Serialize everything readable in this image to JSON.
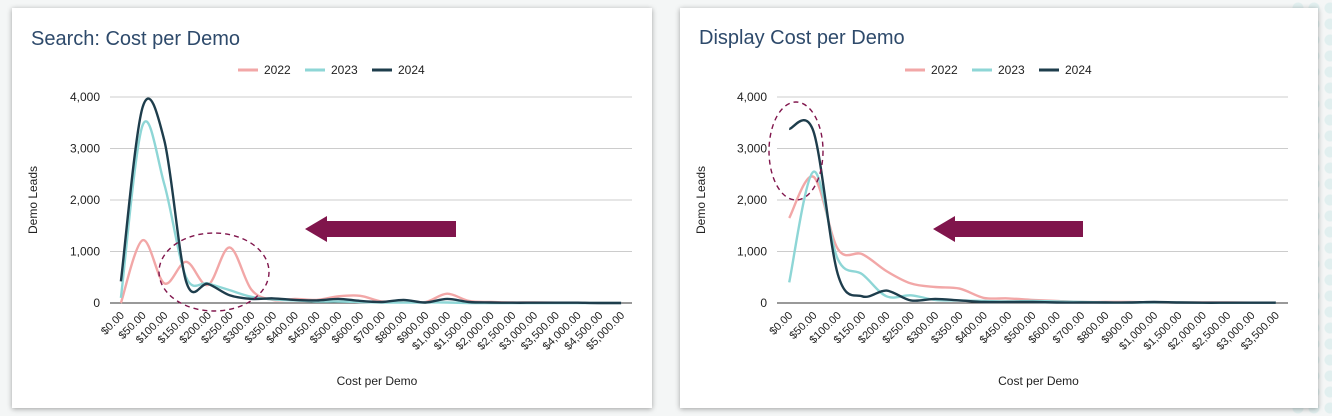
{
  "charts": [
    {
      "title": "Search: Cost per Demo",
      "chart_data": {
        "type": "line",
        "title": "Search: Cost per Demo",
        "xlabel": "Cost per Demo",
        "ylabel": "Demo Leads",
        "ylim": [
          0,
          4000
        ],
        "yticks": [
          "0",
          "1,000",
          "2,000",
          "3,000",
          "4,000"
        ],
        "grid": true,
        "legend_position": "top",
        "categories": [
          "$0.00",
          "$50.00",
          "$100.00",
          "$150.00",
          "$200.00",
          "$250.00",
          "$300.00",
          "$350.00",
          "$400.00",
          "$450.00",
          "$500.00",
          "$600.00",
          "$700.00",
          "$800.00",
          "$900.00",
          "$1,000.00",
          "$1,500.00",
          "$2,000.00",
          "$2,500.00",
          "$3,000.00",
          "$3,500.00",
          "$4,000.00",
          "$4,500.00",
          "$5,000.00"
        ],
        "series": [
          {
            "name": "2022",
            "color": "#f2a7a7",
            "values": [
              0,
              1220,
              380,
              800,
              350,
              1080,
              260,
              60,
              80,
              60,
              130,
              140,
              30,
              50,
              20,
              180,
              40,
              20,
              10,
              10,
              5,
              5,
              0,
              0
            ]
          },
          {
            "name": "2023",
            "color": "#8ed6d6",
            "values": [
              100,
              3450,
              2300,
              500,
              380,
              250,
              120,
              70,
              50,
              30,
              30,
              20,
              10,
              10,
              10,
              10,
              0,
              0,
              0,
              0,
              0,
              0,
              0,
              0
            ]
          },
          {
            "name": "2024",
            "color": "#1e3d4c",
            "values": [
              420,
              3800,
              3150,
              420,
              370,
              150,
              80,
              90,
              60,
              50,
              80,
              40,
              20,
              60,
              10,
              80,
              20,
              10,
              5,
              5,
              5,
              5,
              0,
              0
            ]
          }
        ]
      }
    },
    {
      "title": "Display Cost per Demo",
      "chart_data": {
        "type": "line",
        "title": "Display Cost per Demo",
        "xlabel": "Cost per Demo",
        "ylabel": "Demo Leads",
        "ylim": [
          0,
          4000
        ],
        "yticks": [
          "0",
          "1,000",
          "2,000",
          "3,000",
          "4,000"
        ],
        "grid": true,
        "legend_position": "top",
        "categories": [
          "$0.00",
          "$50.00",
          "$100.00",
          "$150.00",
          "$200.00",
          "$250.00",
          "$300.00",
          "$350.00",
          "$400.00",
          "$450.00",
          "$500.00",
          "$600.00",
          "$700.00",
          "$800.00",
          "$900.00",
          "$1,000.00",
          "$1,500.00",
          "$2,000.00",
          "$2,500.00",
          "$3,000.00",
          "$3,500.00"
        ],
        "series": [
          {
            "name": "2022",
            "color": "#f2a7a7",
            "values": [
              1650,
              2450,
              1050,
              950,
              620,
              380,
              310,
              280,
              100,
              90,
              60,
              40,
              20,
              20,
              20,
              10,
              10,
              10,
              10,
              5,
              5
            ]
          },
          {
            "name": "2023",
            "color": "#8ed6d6",
            "values": [
              400,
              2550,
              850,
              560,
              130,
              150,
              60,
              50,
              40,
              30,
              40,
              30,
              20,
              10,
              10,
              10,
              10,
              5,
              5,
              5,
              5
            ]
          },
          {
            "name": "2024",
            "color": "#1e3d4c",
            "values": [
              3380,
              3330,
              560,
              130,
              240,
              50,
              80,
              50,
              20,
              20,
              20,
              10,
              10,
              10,
              10,
              20,
              10,
              5,
              5,
              5,
              5
            ]
          }
        ]
      }
    }
  ]
}
